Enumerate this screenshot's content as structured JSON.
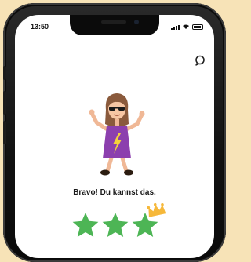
{
  "status_bar": {
    "time": "13:50"
  },
  "header": {
    "chat_icon": "chat-bubble-icon"
  },
  "result": {
    "message": "Bravo! Du kannst das.",
    "stars_total": 3,
    "stars_earned": 3
  },
  "colors": {
    "star": "#4db555",
    "crown": "#f6b83a",
    "shirt": "#8c3fae",
    "background": "#f7e3b7"
  }
}
